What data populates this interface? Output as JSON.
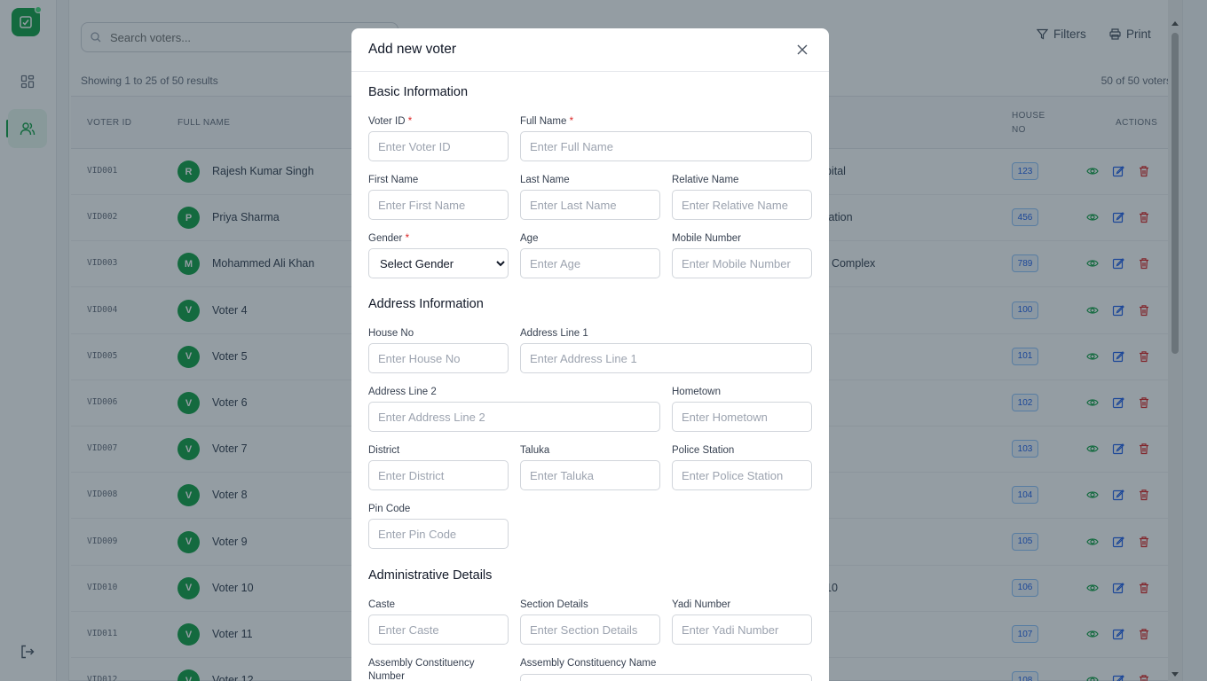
{
  "app": {
    "accent": "#16a34a"
  },
  "sidebar": {
    "items": [
      {
        "name": "dashboard",
        "icon": "grid-icon",
        "active": false
      },
      {
        "name": "voters",
        "icon": "users-icon",
        "active": true
      }
    ],
    "logout_icon": "logout-icon"
  },
  "toolbar": {
    "search_placeholder": "Search voters...",
    "filters_label": "Filters",
    "print_label": "Print"
  },
  "results": {
    "showing": "Showing 1 to 25 of 50 results",
    "count": "50 of 50 voters"
  },
  "table": {
    "headers": {
      "voter_id": "VOTER ID",
      "full_name": "FULL NAME",
      "house_no_1": "HOUSE",
      "house_no_2": "NO",
      "actions": "ACTIONS"
    },
    "rows": [
      {
        "id": "VID001",
        "initial": "R",
        "name": "Rajesh Kumar Singh",
        "addr": "pital",
        "house": "123"
      },
      {
        "id": "VID002",
        "initial": "P",
        "name": "Priya Sharma",
        "addr": "tation",
        "house": "456"
      },
      {
        "id": "VID003",
        "initial": "M",
        "name": "Mohammed Ali Khan",
        "addr": "t Complex",
        "house": "789"
      },
      {
        "id": "VID004",
        "initial": "V",
        "name": "Voter 4",
        "addr": "",
        "house": "100"
      },
      {
        "id": "VID005",
        "initial": "V",
        "name": "Voter 5",
        "addr": "",
        "house": "101"
      },
      {
        "id": "VID006",
        "initial": "V",
        "name": "Voter 6",
        "addr": "",
        "house": "102"
      },
      {
        "id": "VID007",
        "initial": "V",
        "name": "Voter 7",
        "addr": "",
        "house": "103"
      },
      {
        "id": "VID008",
        "initial": "V",
        "name": "Voter 8",
        "addr": "",
        "house": "104"
      },
      {
        "id": "VID009",
        "initial": "V",
        "name": "Voter 9",
        "addr": "",
        "house": "105"
      },
      {
        "id": "VID010",
        "initial": "V",
        "name": "Voter 10",
        "addr": "10",
        "house": "106"
      },
      {
        "id": "VID011",
        "initial": "V",
        "name": "Voter 11",
        "addr": "",
        "house": "107"
      },
      {
        "id": "VID012",
        "initial": "V",
        "name": "Voter 12",
        "addr": "",
        "house": "108"
      }
    ]
  },
  "modal": {
    "title": "Add new voter",
    "sections": {
      "basic": "Basic Information",
      "address": "Address Information",
      "admin": "Administrative Details"
    },
    "fields": {
      "voter_id": {
        "label": "Voter ID",
        "placeholder": "Enter Voter ID",
        "required": "*"
      },
      "full_name": {
        "label": "Full Name",
        "placeholder": "Enter Full Name",
        "required": "*"
      },
      "first_name": {
        "label": "First Name",
        "placeholder": "Enter First Name"
      },
      "last_name": {
        "label": "Last Name",
        "placeholder": "Enter Last Name"
      },
      "relative_name": {
        "label": "Relative Name",
        "placeholder": "Enter Relative Name"
      },
      "gender": {
        "label": "Gender",
        "selected": "Select Gender",
        "required": "*"
      },
      "age": {
        "label": "Age",
        "placeholder": "Enter Age"
      },
      "mobile": {
        "label": "Mobile Number",
        "placeholder": "Enter Mobile Number"
      },
      "house_no": {
        "label": "House No",
        "placeholder": "Enter House No"
      },
      "address1": {
        "label": "Address Line 1",
        "placeholder": "Enter Address Line 1"
      },
      "address2": {
        "label": "Address Line 2",
        "placeholder": "Enter Address Line 2"
      },
      "hometown": {
        "label": "Hometown",
        "placeholder": "Enter Hometown"
      },
      "district": {
        "label": "District",
        "placeholder": "Enter District"
      },
      "taluka": {
        "label": "Taluka",
        "placeholder": "Enter Taluka"
      },
      "police_station": {
        "label": "Police Station",
        "placeholder": "Enter Police Station"
      },
      "pin_code": {
        "label": "Pin Code",
        "placeholder": "Enter Pin Code"
      },
      "caste": {
        "label": "Caste",
        "placeholder": "Enter Caste"
      },
      "section_details": {
        "label": "Section Details",
        "placeholder": "Enter Section Details"
      },
      "yadi_number": {
        "label": "Yadi Number",
        "placeholder": "Enter Yadi Number"
      },
      "ac_number": {
        "label1": "Assembly Constituency",
        "label2": "Number"
      },
      "ac_name": {
        "label": "Assembly Constituency Name"
      }
    }
  }
}
